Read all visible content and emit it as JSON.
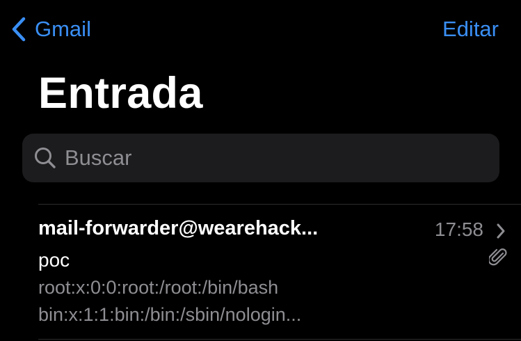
{
  "nav": {
    "back_label": "Gmail",
    "edit_label": "Editar"
  },
  "title": "Entrada",
  "search": {
    "placeholder": "Buscar",
    "value": ""
  },
  "messages": [
    {
      "sender": "mail-forwarder@wearehack...",
      "time": "17:58",
      "subject": "poc",
      "preview_lines": [
        "root:x:0:0:root:/root:/bin/bash",
        "bin:x:1:1:bin:/bin:/sbin/nologin..."
      ],
      "has_attachment": true
    }
  ],
  "colors": {
    "accent": "#3a8ff5",
    "background": "#000000",
    "search_bg": "#1c1c1e",
    "secondary_text": "#8e8e93"
  },
  "icons": [
    "chevron-left-icon",
    "search-icon",
    "chevron-right-icon",
    "paperclip-icon"
  ]
}
